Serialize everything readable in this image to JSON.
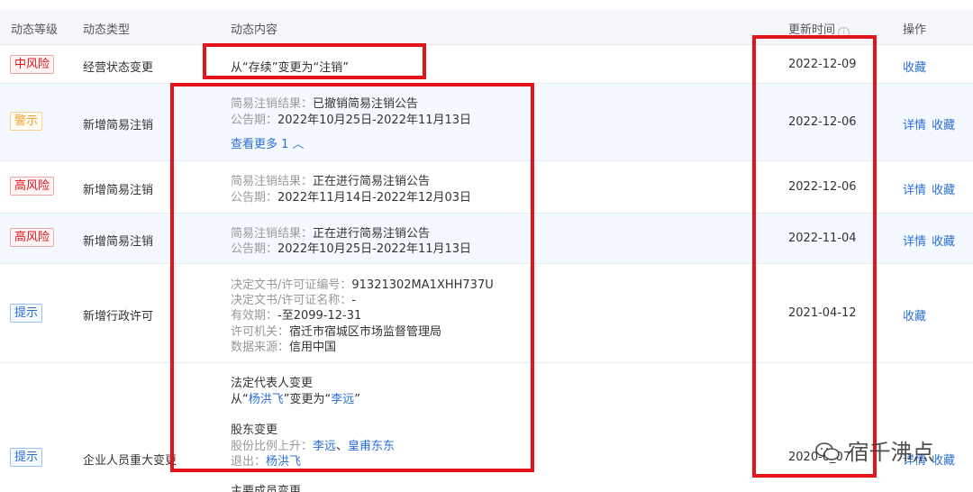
{
  "header": {
    "level": "动态等级",
    "type": "动态类型",
    "content": "动态内容",
    "time": "更新时间",
    "time_info_icon": "i",
    "actions": "操作"
  },
  "colors": {
    "red": "#e3151a",
    "orange": "#f5a32f",
    "blue": "#2b6fd6",
    "highlight": "#e3151a"
  },
  "rows": [
    {
      "level": "中风险",
      "type": "经营状态变更",
      "date": "2022-12-09",
      "actions": [
        "收藏"
      ],
      "content_plain": "从“存续”变更为“注销”"
    },
    {
      "level": "警示",
      "type": "新增简易注销",
      "date": "2022-12-06",
      "actions": [
        "详情",
        "收藏"
      ],
      "l1_label": "简易注销结果：",
      "l1_value": "已撤销简易注销公告",
      "l2_label": "公告期：",
      "l2_value": "2022年10月25日-2022年11月13日",
      "more": "查看更多 1 ︿"
    },
    {
      "level": "高风险",
      "type": "新增简易注销",
      "date": "2022-12-06",
      "actions": [
        "详情",
        "收藏"
      ],
      "l1_label": "简易注销结果：",
      "l1_value": "正在进行简易注销公告",
      "l2_label": "公告期：",
      "l2_value": "2022年11月14日-2022年12月03日"
    },
    {
      "level": "高风险",
      "type": "新增简易注销",
      "date": "2022-11-04",
      "actions": [
        "详情",
        "收藏"
      ],
      "l1_label": "简易注销结果：",
      "l1_value": "正在进行简易注销公告",
      "l2_label": "公告期：",
      "l2_value": "2022年10月25日-2022年11月13日"
    },
    {
      "level": "提示",
      "type": "新增行政许可",
      "date": "2021-04-12",
      "actions": [
        "收藏"
      ],
      "f1_label": "决定文书/许可证编号：",
      "f1_value": "91321302MA1XHH737U",
      "f2_label": "决定文书/许可证名称：",
      "f2_value": "-",
      "f3_label": "有效期：",
      "f3_value": "-至2099-12-31",
      "f4_label": "许可机关：",
      "f4_value": "宿迁市宿城区市场监督管理局",
      "f5_label": "数据来源：",
      "f5_value": "信用中国"
    },
    {
      "level": "提示",
      "type": "企业人员重大变更",
      "date": "2020-0_07",
      "actions": [
        "详情",
        "收藏"
      ],
      "s1_title": "法定代表人变更",
      "s1_prefix": "从“",
      "s1_from": "杨洪飞",
      "s1_mid": "”变更为“",
      "s1_to": "李远",
      "s1_suffix": "”",
      "s2_title": "股东变更",
      "s2_label": "股份比例上升：",
      "s2_a": "李远",
      "s2_sep": "、",
      "s2_b": "皇甫东东",
      "s2_exit_label": "退出：",
      "s2_exit": "杨洪飞",
      "s3_title": "主要成员变更"
    }
  ],
  "watermark": "宿千沸点"
}
